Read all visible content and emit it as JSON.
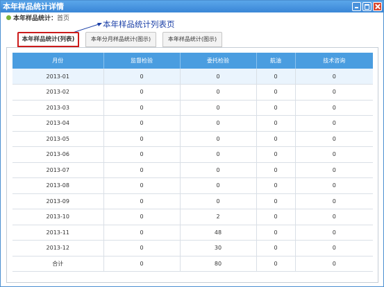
{
  "window": {
    "title": "本年样品统计详情",
    "title_color": "#3a86d6"
  },
  "breadcrumb": {
    "label": "本年样品统计：",
    "home": "首页"
  },
  "annotation": {
    "text": "本年样品统计列表页",
    "color": "#1a3fa7"
  },
  "tabs": [
    {
      "label": "本年样品统计(列表)",
      "active": true
    },
    {
      "label": "本年分月样品统计(图示)",
      "active": false
    },
    {
      "label": "本年样品统计(图示)",
      "active": false
    }
  ],
  "table": {
    "headers": [
      "月份",
      "监督检验",
      "委托检验",
      "航油",
      "技术咨询"
    ],
    "rows": [
      [
        "2013-01",
        "0",
        "0",
        "0",
        "0"
      ],
      [
        "2013-02",
        "0",
        "0",
        "0",
        "0"
      ],
      [
        "2013-03",
        "0",
        "0",
        "0",
        "0"
      ],
      [
        "2013-04",
        "0",
        "0",
        "0",
        "0"
      ],
      [
        "2013-05",
        "0",
        "0",
        "0",
        "0"
      ],
      [
        "2013-06",
        "0",
        "0",
        "0",
        "0"
      ],
      [
        "2013-07",
        "0",
        "0",
        "0",
        "0"
      ],
      [
        "2013-08",
        "0",
        "0",
        "0",
        "0"
      ],
      [
        "2013-09",
        "0",
        "0",
        "0",
        "0"
      ],
      [
        "2013-10",
        "0",
        "2",
        "0",
        "0"
      ],
      [
        "2013-11",
        "0",
        "48",
        "0",
        "0"
      ],
      [
        "2013-12",
        "0",
        "30",
        "0",
        "0"
      ],
      [
        "合计",
        "0",
        "80",
        "0",
        "0"
      ]
    ],
    "header_color": "#4a9de0"
  }
}
